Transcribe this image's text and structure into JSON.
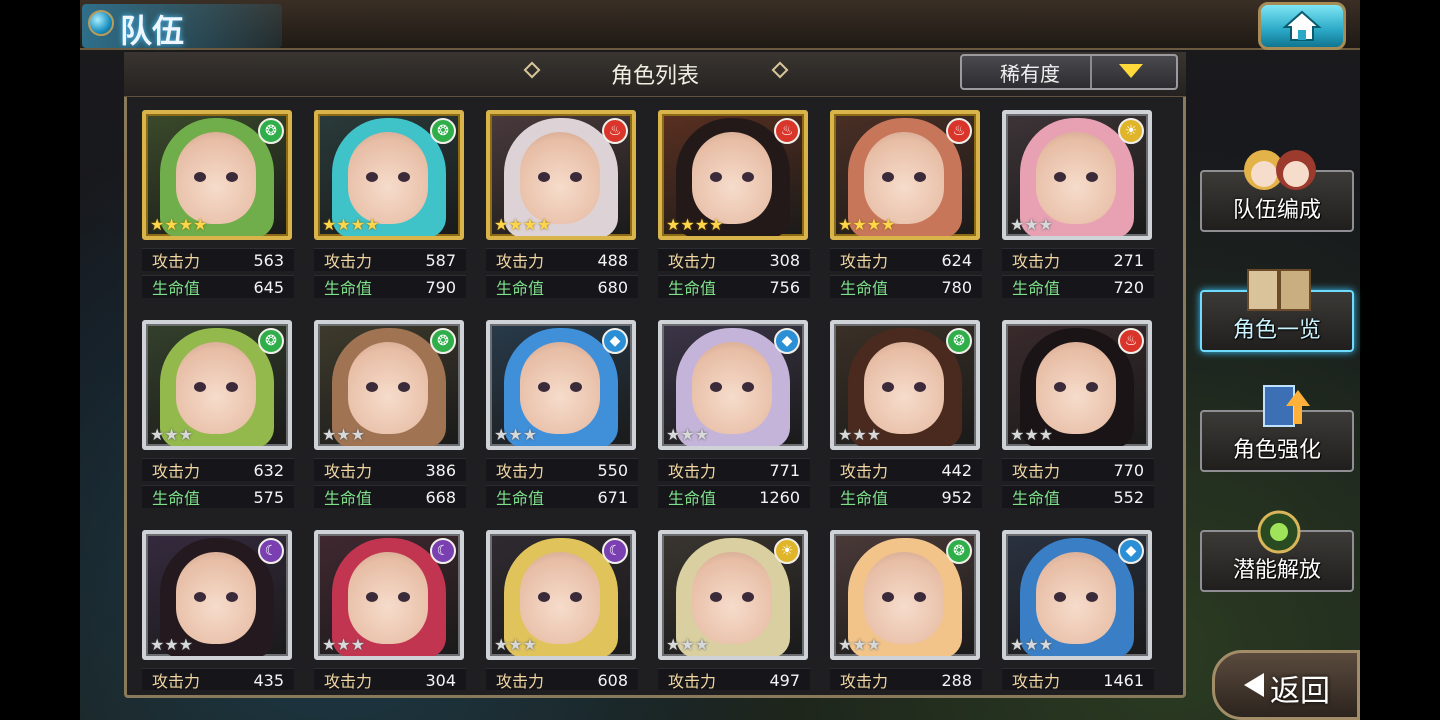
{
  "header": {
    "title": "队伍",
    "home_icon": "home-icon"
  },
  "panel": {
    "title": "角色列表",
    "sort_label": "稀有度"
  },
  "labels": {
    "atk": "攻击力",
    "hp": "生命值"
  },
  "element_colors": {
    "wind": "#2fae4a",
    "fire": "#d9352a",
    "light": "#e0b52a",
    "water": "#2b8fd6",
    "dark": "#7a3fb0"
  },
  "cards": [
    {
      "element": "wind",
      "rarity": 4,
      "atk": "563",
      "hp": "645",
      "hair": "#6fae4a",
      "bg": "#3a4a2a"
    },
    {
      "element": "wind",
      "rarity": 4,
      "atk": "587",
      "hp": "790",
      "hair": "#3fc3c9",
      "bg": "#2a3a3a"
    },
    {
      "element": "fire",
      "rarity": 4,
      "atk": "488",
      "hp": "680",
      "hair": "#ddd3d6",
      "bg": "#4a3a3c"
    },
    {
      "element": "fire",
      "rarity": 4,
      "atk": "308",
      "hp": "756",
      "hair": "#231919",
      "bg": "#5a3020"
    },
    {
      "element": "fire",
      "rarity": 4,
      "atk": "624",
      "hp": "780",
      "hair": "#c8765a",
      "bg": "#4a2f25"
    },
    {
      "element": "light",
      "rarity": 3,
      "atk": "271",
      "hp": "720",
      "hair": "#e7a1b3",
      "bg": "#3d3437"
    },
    {
      "element": "wind",
      "rarity": 3,
      "atk": "632",
      "hp": "575",
      "hair": "#93b94c",
      "bg": "#34402b"
    },
    {
      "element": "wind",
      "rarity": 3,
      "atk": "386",
      "hp": "668",
      "hair": "#a07352",
      "bg": "#3e3a2c"
    },
    {
      "element": "water",
      "rarity": 3,
      "atk": "550",
      "hp": "671",
      "hair": "#3f8fd9",
      "bg": "#283a4a"
    },
    {
      "element": "water",
      "rarity": 3,
      "atk": "771",
      "hp": "1260",
      "hair": "#c5b4d9",
      "bg": "#3b3547"
    },
    {
      "element": "wind",
      "rarity": 3,
      "atk": "442",
      "hp": "952",
      "hair": "#4a2a1e",
      "bg": "#3a3026"
    },
    {
      "element": "fire",
      "rarity": 3,
      "atk": "770",
      "hp": "552",
      "hair": "#1b1416",
      "bg": "#3a2a2c"
    },
    {
      "element": "dark",
      "rarity": 3,
      "atk": "435",
      "hp": "",
      "hair": "#24191e",
      "bg": "#352a3e"
    },
    {
      "element": "dark",
      "rarity": 3,
      "atk": "304",
      "hp": "",
      "hair": "#c23551",
      "bg": "#402830"
    },
    {
      "element": "dark",
      "rarity": 3,
      "atk": "608",
      "hp": "",
      "hair": "#e0c35a",
      "bg": "#2f2a30"
    },
    {
      "element": "light",
      "rarity": 3,
      "atk": "497",
      "hp": "",
      "hair": "#d9cfa0",
      "bg": "#3a3530"
    },
    {
      "element": "wind",
      "rarity": 3,
      "atk": "288",
      "hp": "",
      "hair": "#f2c48a",
      "bg": "#4a3a38"
    },
    {
      "element": "water",
      "rarity": 3,
      "atk": "1461",
      "hp": "",
      "hair": "#3a7fc5",
      "bg": "#2a3240"
    }
  ],
  "side_menu": [
    {
      "label": "队伍编成",
      "icon": "team-portraits-icon",
      "active": false
    },
    {
      "label": "角色一览",
      "icon": "book-icon",
      "active": true
    },
    {
      "label": "角色强化",
      "icon": "card-upgrade-icon",
      "active": false
    },
    {
      "label": "潜能解放",
      "icon": "potential-orb-icon",
      "active": false
    }
  ],
  "back": {
    "label": "返回",
    "icon": "back-arrow-icon"
  }
}
